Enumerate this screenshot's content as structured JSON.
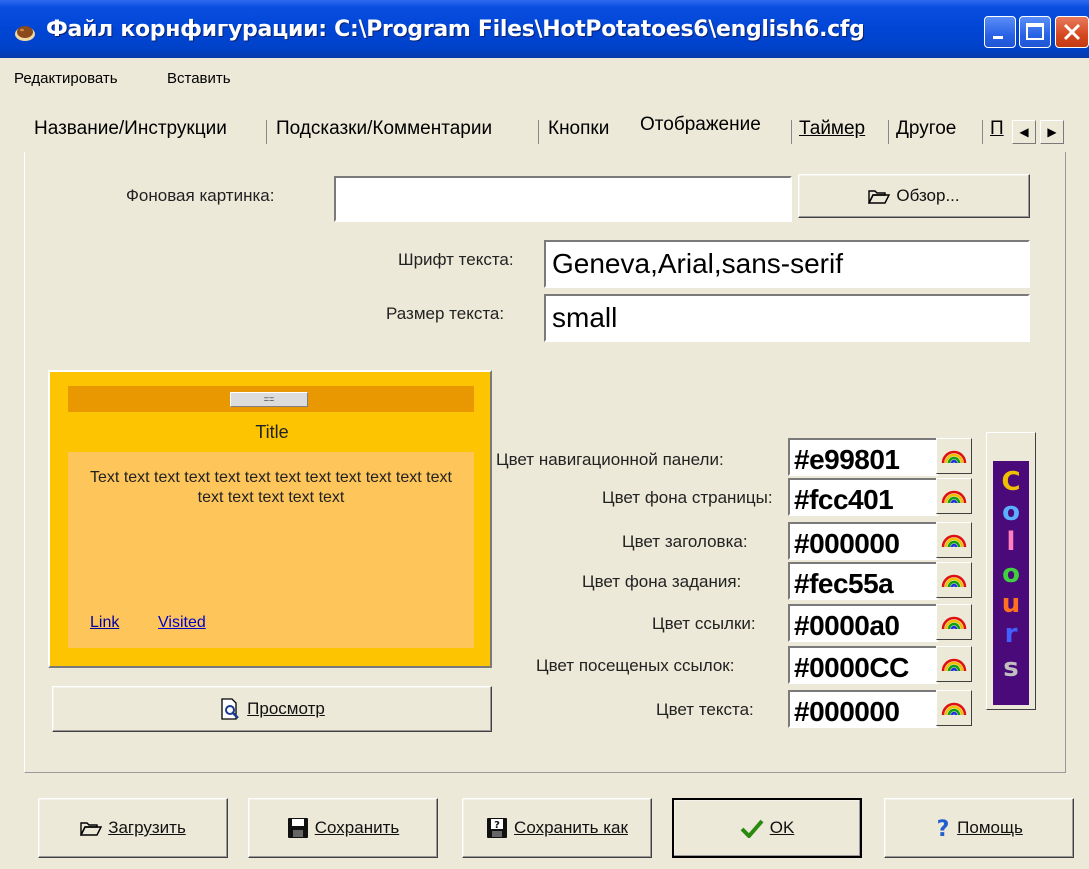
{
  "window": {
    "title": "Файл корнфигурации: C:\\Program Files\\HotPotatoes6\\english6.cfg",
    "icon": "app-icon",
    "controls": [
      "minimize-icon",
      "maximize-icon",
      "close-icon"
    ]
  },
  "menu": {
    "items": [
      "Редактировать",
      "Вставить"
    ]
  },
  "tabs": {
    "items": [
      "Название/Инструкции",
      "Подсказки/Комментарии",
      "Кнопки",
      "Отображение",
      "Таймер",
      "Другое",
      "П"
    ],
    "active": "Отображение"
  },
  "display": {
    "bg_label": "Фоновая картинка:",
    "bg_value": "",
    "browse_label": "Обзор...",
    "font_label": "Шрифт текста:",
    "font_value": "Geneva,Arial,sans-serif",
    "size_label": "Размер текста:",
    "size_value": "small"
  },
  "preview": {
    "nav_button": "==",
    "title": "Title",
    "text": "Text text text text text text text text text text text text text text text text text",
    "link": "Link",
    "visited": "Visited",
    "button_label": "Просмотр"
  },
  "colors": [
    {
      "label": "Цвет навигационной панели:",
      "value": "#e99801"
    },
    {
      "label": "Цвет фона страницы:",
      "value": "#fcc401"
    },
    {
      "label": "Цвет заголовка:",
      "value": "#000000"
    },
    {
      "label": "Цвет фона задания:",
      "value": "#fec55a"
    },
    {
      "label": "Цвет ссылки:",
      "value": "#0000a0"
    },
    {
      "label": "Цвет посещеных ссылок:",
      "value": "#0000CC"
    },
    {
      "label": "Цвет текста:",
      "value": "#000000"
    }
  ],
  "colours_button": {
    "letters": [
      "C",
      "o",
      "l",
      "o",
      "u",
      "r",
      "s"
    ]
  },
  "bottom": {
    "load": "Загрузить",
    "save": "Сохранить",
    "save_as": "Сохранить как",
    "ok": "OK",
    "help": "Помощь"
  }
}
